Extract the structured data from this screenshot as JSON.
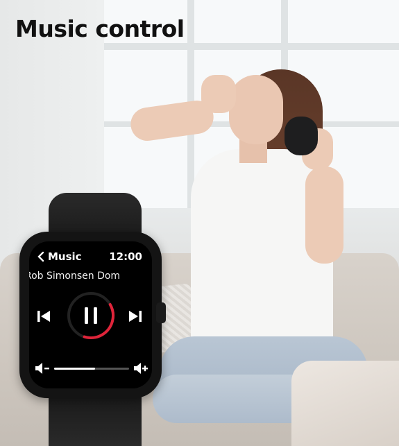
{
  "banner": {
    "title": "Music control"
  },
  "watch": {
    "screen": {
      "header": {
        "back_icon": "chevron-left-icon",
        "title": "Music",
        "time": "12:00"
      },
      "now_playing": {
        "track_text": "Rob Simonsen Dom"
      },
      "controls": {
        "previous_icon": "skip-previous-icon",
        "play_pause_icon": "pause-icon",
        "next_icon": "skip-next-icon",
        "progress_fraction": 0.38,
        "progress_color": "#e0243a"
      },
      "volume": {
        "down_icon": "volume-down-icon",
        "up_icon": "volume-up-icon",
        "level_fraction": 0.55
      }
    }
  }
}
